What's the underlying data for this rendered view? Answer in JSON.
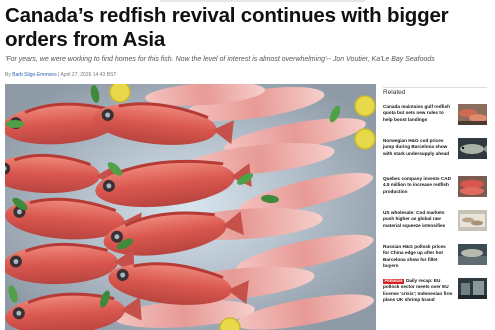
{
  "article": {
    "headline": "Canada’s redfish revival continues with bigger orders from Asia",
    "quote": "'For years, we were working to find homes for this fish. Now the level of interest is almost overwhelming'-- Jon Voutier, Ka'Le Bay Seafoods",
    "byline": {
      "prefix": "By",
      "author": "Barb Sligo-Emmons",
      "separator": "|",
      "date": "April 27, 2026 14:43 BST"
    },
    "hero_image": "redfish-on-ice-photo"
  },
  "sidebar": {
    "title": "Related",
    "items": [
      {
        "text": "Canada maintains gulf redfish quota but sets new rules to help boost landings",
        "badge": "",
        "thumb": "fish-catch-thumbnail"
      },
      {
        "text": "Norwegian H&G cod prices jump during Barcelona show with stark undersupply ahead",
        "badge": "",
        "thumb": "cod-fish-thumbnail"
      },
      {
        "text": "Quebec company invests CAD 4.5 million to increase redfish production",
        "badge": "",
        "thumb": "redfish-thumbnail"
      },
      {
        "text": "US wholesale: Cod markets push higher as global raw material squeeze intensifies",
        "badge": "",
        "thumb": "fish-stall-thumbnail"
      },
      {
        "text": "Russian H&G pollock prices for China edge up after hot Barcelona show for fillet buyers",
        "badge": "",
        "thumb": "pollock-thumbnail"
      },
      {
        "text": "Daily recap: EU pollock sector meets over EU license 'crisis'; Indonesian firm plans UK shrimp brand",
        "badge": "PREMIUM",
        "thumb": "seafood-plant-thumbnail"
      }
    ]
  },
  "colors": {
    "headline": "#111111",
    "author_link": "#2b63b0",
    "badge": "#d42323"
  }
}
